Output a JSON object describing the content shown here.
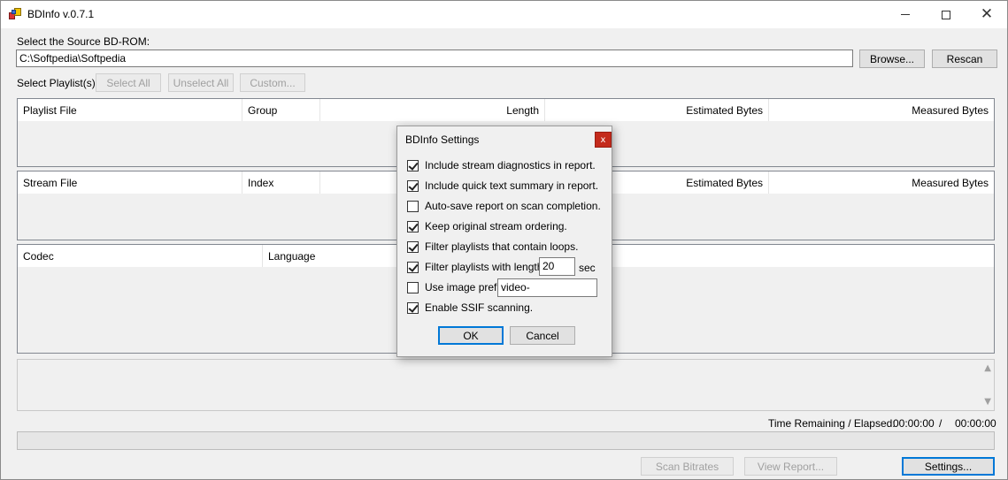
{
  "window": {
    "title": "BDInfo v.0.7.1"
  },
  "source": {
    "label": "Select the Source BD-ROM:",
    "path": "C:\\Softpedia\\Softpedia",
    "browse_label": "Browse...",
    "rescan_label": "Rescan"
  },
  "playlists": {
    "label": "Select Playlist(s):",
    "select_all": "Select All",
    "unselect_all": "Unselect All",
    "custom": "Custom...",
    "columns": [
      "Playlist File",
      "Group",
      "Length",
      "Estimated Bytes",
      "Measured Bytes"
    ]
  },
  "streams": {
    "columns": [
      "Stream File",
      "Index",
      "Estimated Bytes",
      "Measured Bytes"
    ]
  },
  "codecs": {
    "columns": [
      "Codec",
      "Language"
    ]
  },
  "status": {
    "time_label": "Time Remaining / Elapsed:",
    "remaining": "00:00:00",
    "separator": "/",
    "elapsed": "00:00:00"
  },
  "bottom": {
    "scan_bitrates": "Scan Bitrates",
    "view_report": "View Report...",
    "settings": "Settings..."
  },
  "dialog": {
    "title": "BDInfo Settings",
    "close": "x",
    "options": [
      {
        "label": "Include stream diagnostics in report.",
        "checked": true
      },
      {
        "label": "Include quick text summary in report.",
        "checked": true
      },
      {
        "label": "Auto-save report on scan completion.",
        "checked": false
      },
      {
        "label": "Keep original stream ordering.",
        "checked": true
      },
      {
        "label": "Filter playlists that contain loops.",
        "checked": true
      },
      {
        "label": "Filter playlists with length <",
        "checked": true
      },
      {
        "label": "Use image prefix",
        "checked": false
      },
      {
        "label": "Enable SSIF scanning.",
        "checked": true
      }
    ],
    "length_value": "20",
    "length_unit": "sec",
    "prefix_value": "video-",
    "ok": "OK",
    "cancel": "Cancel"
  }
}
